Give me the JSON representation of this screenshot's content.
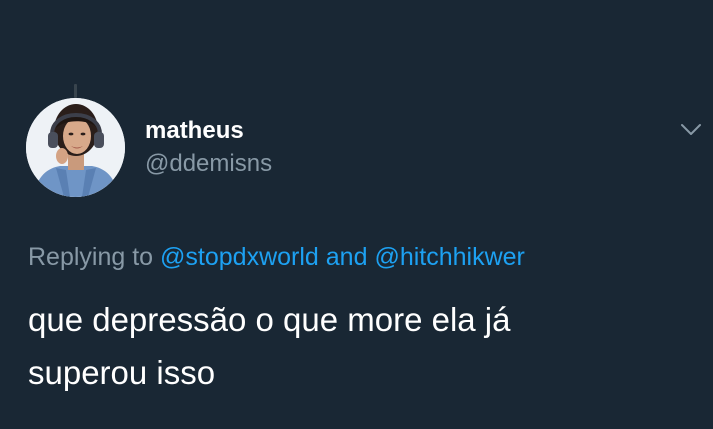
{
  "theme": {
    "background": "#192734",
    "primary_text": "#ffffff",
    "secondary_text": "#8899a6",
    "link": "#1da1f2"
  },
  "user": {
    "display_name": "matheus",
    "handle": "@ddemisns",
    "avatar_icon": "profile-photo"
  },
  "menu": {
    "icon": "chevron-down-icon"
  },
  "reply": {
    "prefix": "Replying to",
    "mention_1": "@stopdxworld",
    "joiner": "and",
    "mention_2": "@hitchhikwer"
  },
  "tweet": {
    "lines": [
      "que depressão o que more ela já",
      "superou isso"
    ]
  }
}
